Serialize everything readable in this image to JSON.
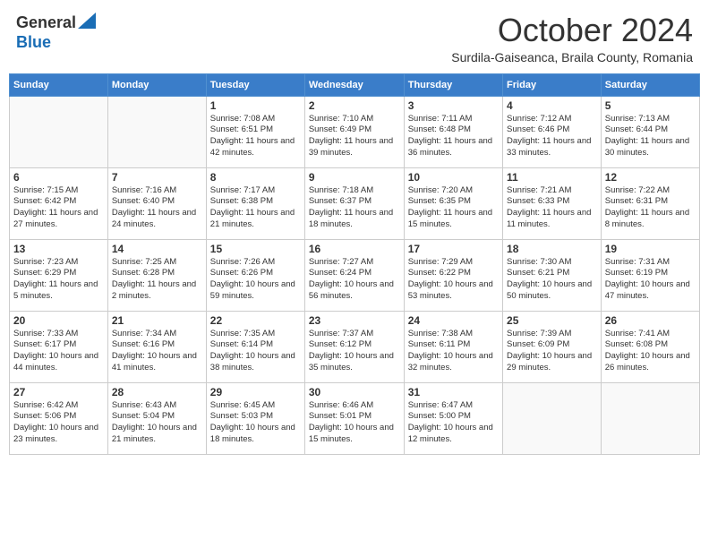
{
  "header": {
    "logo_general": "General",
    "logo_blue": "Blue",
    "month_title": "October 2024",
    "location": "Surdila-Gaiseanca, Braila County, Romania"
  },
  "days_of_week": [
    "Sunday",
    "Monday",
    "Tuesday",
    "Wednesday",
    "Thursday",
    "Friday",
    "Saturday"
  ],
  "weeks": [
    [
      {
        "day": "",
        "sunrise": "",
        "sunset": "",
        "daylight": ""
      },
      {
        "day": "",
        "sunrise": "",
        "sunset": "",
        "daylight": ""
      },
      {
        "day": "1",
        "sunrise": "Sunrise: 7:08 AM",
        "sunset": "Sunset: 6:51 PM",
        "daylight": "Daylight: 11 hours and 42 minutes."
      },
      {
        "day": "2",
        "sunrise": "Sunrise: 7:10 AM",
        "sunset": "Sunset: 6:49 PM",
        "daylight": "Daylight: 11 hours and 39 minutes."
      },
      {
        "day": "3",
        "sunrise": "Sunrise: 7:11 AM",
        "sunset": "Sunset: 6:48 PM",
        "daylight": "Daylight: 11 hours and 36 minutes."
      },
      {
        "day": "4",
        "sunrise": "Sunrise: 7:12 AM",
        "sunset": "Sunset: 6:46 PM",
        "daylight": "Daylight: 11 hours and 33 minutes."
      },
      {
        "day": "5",
        "sunrise": "Sunrise: 7:13 AM",
        "sunset": "Sunset: 6:44 PM",
        "daylight": "Daylight: 11 hours and 30 minutes."
      }
    ],
    [
      {
        "day": "6",
        "sunrise": "Sunrise: 7:15 AM",
        "sunset": "Sunset: 6:42 PM",
        "daylight": "Daylight: 11 hours and 27 minutes."
      },
      {
        "day": "7",
        "sunrise": "Sunrise: 7:16 AM",
        "sunset": "Sunset: 6:40 PM",
        "daylight": "Daylight: 11 hours and 24 minutes."
      },
      {
        "day": "8",
        "sunrise": "Sunrise: 7:17 AM",
        "sunset": "Sunset: 6:38 PM",
        "daylight": "Daylight: 11 hours and 21 minutes."
      },
      {
        "day": "9",
        "sunrise": "Sunrise: 7:18 AM",
        "sunset": "Sunset: 6:37 PM",
        "daylight": "Daylight: 11 hours and 18 minutes."
      },
      {
        "day": "10",
        "sunrise": "Sunrise: 7:20 AM",
        "sunset": "Sunset: 6:35 PM",
        "daylight": "Daylight: 11 hours and 15 minutes."
      },
      {
        "day": "11",
        "sunrise": "Sunrise: 7:21 AM",
        "sunset": "Sunset: 6:33 PM",
        "daylight": "Daylight: 11 hours and 11 minutes."
      },
      {
        "day": "12",
        "sunrise": "Sunrise: 7:22 AM",
        "sunset": "Sunset: 6:31 PM",
        "daylight": "Daylight: 11 hours and 8 minutes."
      }
    ],
    [
      {
        "day": "13",
        "sunrise": "Sunrise: 7:23 AM",
        "sunset": "Sunset: 6:29 PM",
        "daylight": "Daylight: 11 hours and 5 minutes."
      },
      {
        "day": "14",
        "sunrise": "Sunrise: 7:25 AM",
        "sunset": "Sunset: 6:28 PM",
        "daylight": "Daylight: 11 hours and 2 minutes."
      },
      {
        "day": "15",
        "sunrise": "Sunrise: 7:26 AM",
        "sunset": "Sunset: 6:26 PM",
        "daylight": "Daylight: 10 hours and 59 minutes."
      },
      {
        "day": "16",
        "sunrise": "Sunrise: 7:27 AM",
        "sunset": "Sunset: 6:24 PM",
        "daylight": "Daylight: 10 hours and 56 minutes."
      },
      {
        "day": "17",
        "sunrise": "Sunrise: 7:29 AM",
        "sunset": "Sunset: 6:22 PM",
        "daylight": "Daylight: 10 hours and 53 minutes."
      },
      {
        "day": "18",
        "sunrise": "Sunrise: 7:30 AM",
        "sunset": "Sunset: 6:21 PM",
        "daylight": "Daylight: 10 hours and 50 minutes."
      },
      {
        "day": "19",
        "sunrise": "Sunrise: 7:31 AM",
        "sunset": "Sunset: 6:19 PM",
        "daylight": "Daylight: 10 hours and 47 minutes."
      }
    ],
    [
      {
        "day": "20",
        "sunrise": "Sunrise: 7:33 AM",
        "sunset": "Sunset: 6:17 PM",
        "daylight": "Daylight: 10 hours and 44 minutes."
      },
      {
        "day": "21",
        "sunrise": "Sunrise: 7:34 AM",
        "sunset": "Sunset: 6:16 PM",
        "daylight": "Daylight: 10 hours and 41 minutes."
      },
      {
        "day": "22",
        "sunrise": "Sunrise: 7:35 AM",
        "sunset": "Sunset: 6:14 PM",
        "daylight": "Daylight: 10 hours and 38 minutes."
      },
      {
        "day": "23",
        "sunrise": "Sunrise: 7:37 AM",
        "sunset": "Sunset: 6:12 PM",
        "daylight": "Daylight: 10 hours and 35 minutes."
      },
      {
        "day": "24",
        "sunrise": "Sunrise: 7:38 AM",
        "sunset": "Sunset: 6:11 PM",
        "daylight": "Daylight: 10 hours and 32 minutes."
      },
      {
        "day": "25",
        "sunrise": "Sunrise: 7:39 AM",
        "sunset": "Sunset: 6:09 PM",
        "daylight": "Daylight: 10 hours and 29 minutes."
      },
      {
        "day": "26",
        "sunrise": "Sunrise: 7:41 AM",
        "sunset": "Sunset: 6:08 PM",
        "daylight": "Daylight: 10 hours and 26 minutes."
      }
    ],
    [
      {
        "day": "27",
        "sunrise": "Sunrise: 6:42 AM",
        "sunset": "Sunset: 5:06 PM",
        "daylight": "Daylight: 10 hours and 23 minutes."
      },
      {
        "day": "28",
        "sunrise": "Sunrise: 6:43 AM",
        "sunset": "Sunset: 5:04 PM",
        "daylight": "Daylight: 10 hours and 21 minutes."
      },
      {
        "day": "29",
        "sunrise": "Sunrise: 6:45 AM",
        "sunset": "Sunset: 5:03 PM",
        "daylight": "Daylight: 10 hours and 18 minutes."
      },
      {
        "day": "30",
        "sunrise": "Sunrise: 6:46 AM",
        "sunset": "Sunset: 5:01 PM",
        "daylight": "Daylight: 10 hours and 15 minutes."
      },
      {
        "day": "31",
        "sunrise": "Sunrise: 6:47 AM",
        "sunset": "Sunset: 5:00 PM",
        "daylight": "Daylight: 10 hours and 12 minutes."
      },
      {
        "day": "",
        "sunrise": "",
        "sunset": "",
        "daylight": ""
      },
      {
        "day": "",
        "sunrise": "",
        "sunset": "",
        "daylight": ""
      }
    ]
  ]
}
